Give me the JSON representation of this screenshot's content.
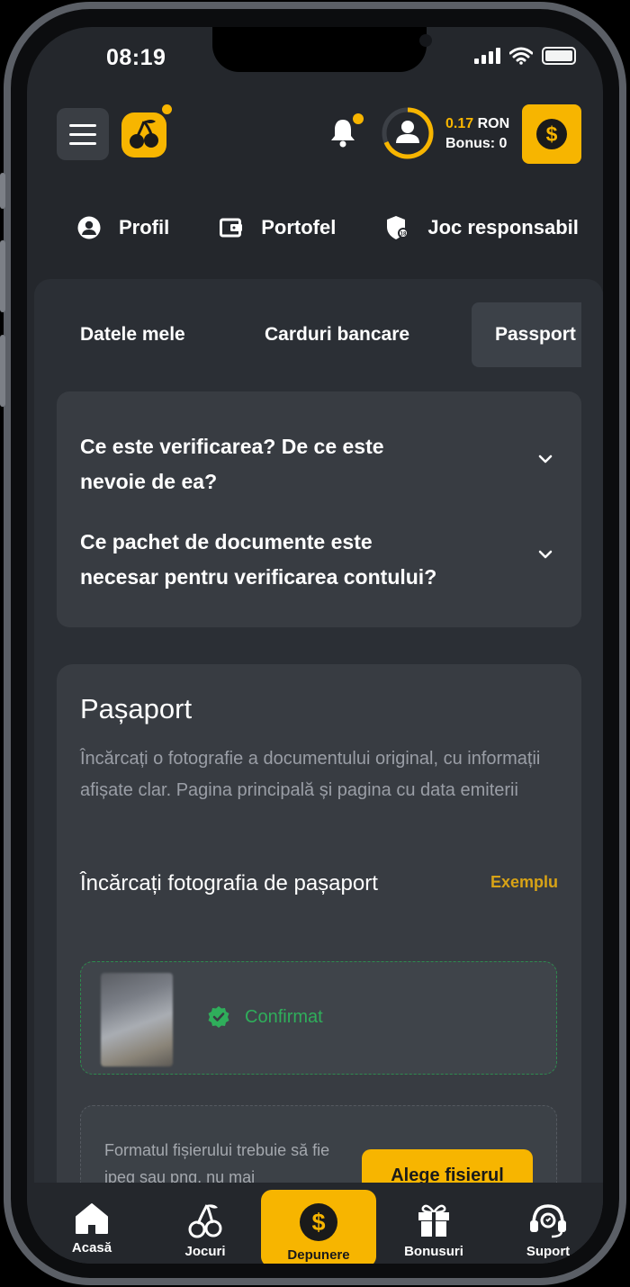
{
  "status_bar": {
    "time": "08:19"
  },
  "header": {
    "balance_amount": "0.17",
    "balance_currency": "RON",
    "bonus_label": "Bonus: 0",
    "icons": [
      "menu-icon",
      "cherry-logo",
      "bell-icon",
      "user-avatar-icon",
      "dollar-coin-icon"
    ]
  },
  "top_nav": [
    {
      "label": "Profil",
      "icon": "user-circle-icon"
    },
    {
      "label": "Portofel",
      "icon": "wallet-icon"
    },
    {
      "label": "Joc responsabil",
      "icon": "shield-icon"
    }
  ],
  "sub_tabs": [
    {
      "label": "Datele mele"
    },
    {
      "label": "Carduri bancare"
    },
    {
      "label": "Passport",
      "active": true
    }
  ],
  "faq": [
    {
      "question_line1": "Ce este verificarea? De ce este",
      "question_line2": "nevoie de ea?"
    },
    {
      "question_line1": "Ce pachet de documente este",
      "question_line2": "necesar pentru verificarea contului?"
    }
  ],
  "passport": {
    "title": "Pașaport",
    "description": "Încărcați o fotografie a documentului original, cu informații afișate clar. Pagina principală și pagina cu data emiterii",
    "upload_label": "Încărcați fotografia de pașaport",
    "example_link": "Exemplu",
    "status": "Confirmat",
    "file_note": "Formatul fișierului trebuie să fie jpeg sau png, nu mai",
    "choose_file": "Alege fisierul"
  },
  "bottom_nav": [
    {
      "label": "Acasă",
      "icon": "home-icon"
    },
    {
      "label": "Jocuri",
      "icon": "cherry-icon"
    },
    {
      "label": "Depunere",
      "icon": "dollar-coin-icon",
      "active": true
    },
    {
      "label": "Bonusuri",
      "icon": "gift-icon"
    },
    {
      "label": "Suport",
      "icon": "headset-icon"
    }
  ],
  "colors": {
    "accent": "#f7b500",
    "success": "#2fae5b",
    "background": "#24272c"
  }
}
